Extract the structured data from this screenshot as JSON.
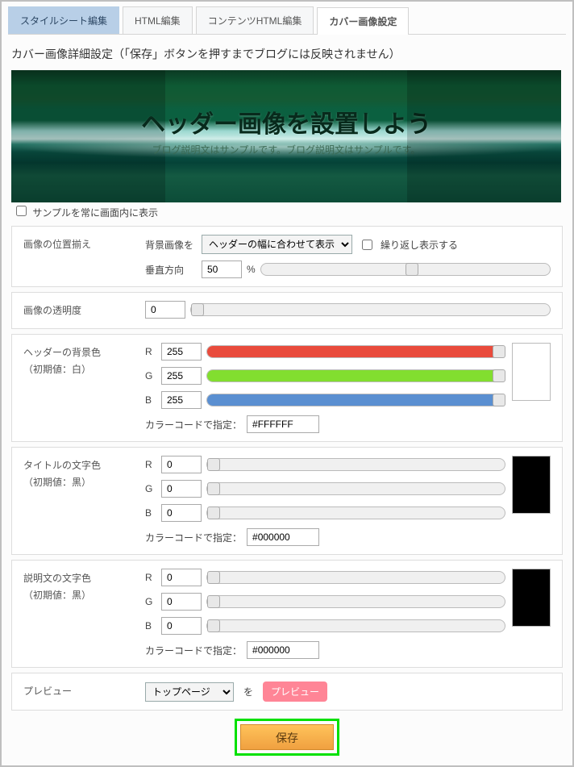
{
  "tabs": {
    "stylesheet": "スタイルシート編集",
    "html": "HTML編集",
    "contents_html": "コンテンツHTML編集",
    "cover": "カバー画像設定"
  },
  "heading": "カバー画像詳細設定（「保存」ボタンを押すまでブログには反映されません）",
  "cover": {
    "title": "ヘッダー画像を設置しよう",
    "subtitle": "ブログ説明文はサンプルです。ブログ説明文はサンプルです。"
  },
  "sample_always_show": "サンプルを常に画面内に表示",
  "position": {
    "label": "画像の位置揃え",
    "bg_label": "背景画像を",
    "fit_option": "ヘッダーの幅に合わせて表示",
    "repeat_label": "繰り返し表示する",
    "vertical_label": "垂直方向",
    "vertical_value": "50",
    "percent": "%"
  },
  "opacity": {
    "label": "画像の透明度",
    "value": "0"
  },
  "header_bg": {
    "label": "ヘッダーの背景色",
    "default": "（初期値：白）",
    "r": "255",
    "g": "255",
    "b": "255",
    "code_label": "カラーコードで指定：",
    "code": "#FFFFFF",
    "swatch": "#ffffff",
    "fill_r": "#e94b3c",
    "fill_g": "#82de2f",
    "fill_b": "#5a8fd1"
  },
  "title_color": {
    "label": "タイトルの文字色",
    "default": "（初期値：黒）",
    "r": "0",
    "g": "0",
    "b": "0",
    "code_label": "カラーコードで指定：",
    "code": "#000000",
    "swatch": "#000000"
  },
  "desc_color": {
    "label": "説明文の文字色",
    "default": "（初期値：黒）",
    "r": "0",
    "g": "0",
    "b": "0",
    "code_label": "カラーコードで指定：",
    "code": "#000000",
    "swatch": "#000000"
  },
  "preview": {
    "label": "プレビュー",
    "option": "トップページ",
    "wo": "を",
    "button": "プレビュー"
  },
  "labels": {
    "r": "R",
    "g": "G",
    "b": "B"
  },
  "save": "保存"
}
